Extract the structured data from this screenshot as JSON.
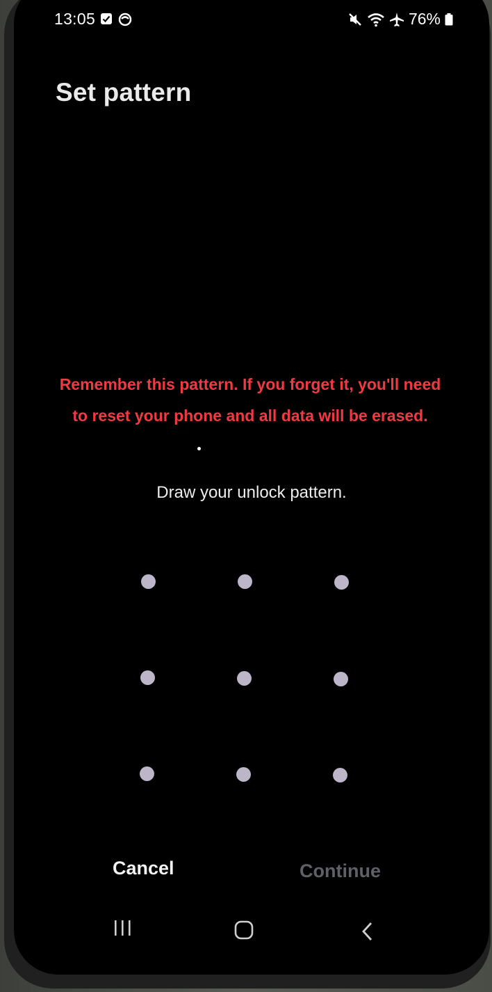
{
  "status_bar": {
    "time": "13:05",
    "battery_percent": "76%",
    "left_icons": [
      "checkbox-notification-icon",
      "circle-app-icon"
    ],
    "right_icons": [
      "mute-icon",
      "wifi-icon",
      "airplane-icon",
      "battery-icon"
    ]
  },
  "page": {
    "title": "Set pattern",
    "warning": "Remember this pattern. If you forget it, you'll need to reset your phone and all data will be erased.",
    "instruction": "Draw your unlock pattern."
  },
  "pattern_grid": {
    "rows": 3,
    "cols": 3,
    "dot_color": "#bcb6c8"
  },
  "actions": {
    "cancel_label": "Cancel",
    "continue_label": "Continue",
    "continue_enabled": false
  },
  "nav_bar": {
    "icons": [
      "recents-icon",
      "home-icon",
      "back-icon"
    ]
  },
  "colors": {
    "background": "#000000",
    "warning": "#ee3b43",
    "disabled": "#5e6168"
  }
}
